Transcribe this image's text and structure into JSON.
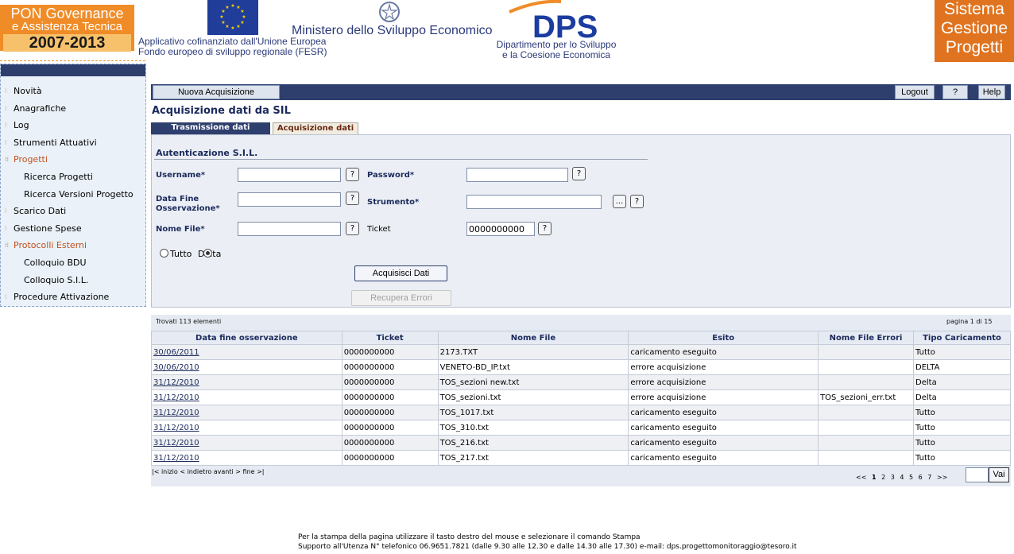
{
  "header": {
    "pon_logo": [
      "PON Governance",
      "e Assistenza Tecnica",
      "2007-2013"
    ],
    "eu_text": [
      "Applicativo cofinanziato dall'Unione Europea",
      "Fondo europeo di sviluppo regionale (FESR)"
    ],
    "ministry": "Ministero dello Sviluppo Economico",
    "dps_logo": "DPS",
    "dps_text": [
      "Dipartimento per lo Sviluppo",
      "e la Coesione Economica"
    ],
    "sgp_logo": [
      "Sistema",
      "Gestione",
      "Progetti"
    ]
  },
  "sidebar": {
    "items": [
      {
        "label": "Novità"
      },
      {
        "label": "Anagrafiche"
      },
      {
        "label": "Log"
      },
      {
        "label": "Strumenti Attuativi"
      },
      {
        "label": "Progetti"
      },
      {
        "label": "Ricerca Progetti"
      },
      {
        "label": "Ricerca Versioni Progetto"
      },
      {
        "label": "Scarico Dati"
      },
      {
        "label": "Gestione Spese"
      },
      {
        "label": "Protocolli Esterni"
      },
      {
        "label": "Colloquio BDU"
      },
      {
        "label": "Colloquio S.I.L."
      },
      {
        "label": "Procedure Attivazione"
      }
    ]
  },
  "toolbar": {
    "new_label": "Nuova Acquisizione",
    "logout_label": "Logout",
    "question_label": "?",
    "help_label": "Help"
  },
  "page": {
    "title": "Acquisizione dati da SIL",
    "tab_transmission": "Trasmissione dati",
    "tab_acquisition": "Acquisizione dati"
  },
  "form": {
    "section_title": "Autenticazione S.I.L.",
    "username_label": "Username*",
    "password_label": "Password*",
    "data_fine_label_1": "Data Fine",
    "data_fine_label_2": "Osservazione*",
    "strumento_label": "Strumento*",
    "nome_file_label": "Nome File*",
    "ticket_label": "Ticket",
    "ticket_value": "0000000000",
    "help_glyph": "?",
    "browse_glyph": "...",
    "radio_tutto": "Tutto",
    "radio_delta": "Delta",
    "acquire_button": "Acquisisci Dati",
    "recover_button": "Recupera Errori"
  },
  "results": {
    "found_text": "Trovati 113 elementi",
    "page_text": "pagina 1 di 15",
    "columns": [
      "Data fine osservazione",
      "Ticket",
      "Nome File",
      "Esito",
      "Nome File Errori",
      "Tipo Caricamento"
    ],
    "rows": [
      [
        "30/06/2011",
        "0000000000",
        "2173.TXT",
        "caricamento eseguito",
        "",
        "Tutto"
      ],
      [
        "30/06/2010",
        "0000000000",
        "VENETO-BD_IP.txt",
        "errore acquisizione",
        "",
        "DELTA"
      ],
      [
        "31/12/2010",
        "0000000000",
        "TOS_sezioni new.txt",
        "errore acquisizione",
        "",
        "Delta"
      ],
      [
        "31/12/2010",
        "0000000000",
        "TOS_sezioni.txt",
        "errore acquisizione",
        "TOS_sezioni_err.txt",
        "Delta"
      ],
      [
        "31/12/2010",
        "0000000000",
        "TOS_1017.txt",
        "caricamento eseguito",
        "",
        "Tutto"
      ],
      [
        "31/12/2010",
        "0000000000",
        "TOS_310.txt",
        "caricamento eseguito",
        "",
        "Tutto"
      ],
      [
        "31/12/2010",
        "0000000000",
        "TOS_216.txt",
        "caricamento eseguito",
        "",
        "Tutto"
      ],
      [
        "31/12/2010",
        "0000000000",
        "TOS_217.txt",
        "caricamento eseguito",
        "",
        "Tutto"
      ]
    ],
    "pager_left": "|< inizio  < indietro avanti >   fine >|",
    "pager_prev": "<<",
    "pager_pages": [
      "1",
      "2",
      "3",
      "4",
      "5",
      "6",
      "7"
    ],
    "pager_next": ">>",
    "go_button": "Vai"
  },
  "footer": {
    "line1": "Per la stampa della pagina utilizzare il tasto destro del mouse e selezionare il comando Stampa",
    "line2": "Supporto all'Utenza N° telefonico 06.9651.7821 (dalle 9.30 alle 12.30 e dalle 14.30 alle 17.30) e-mail: dps.progettomonitoraggio@tesoro.it"
  },
  "colors": {
    "nav_dark": "#2e3f6e",
    "accent_orange": "#f08c28",
    "active_menu": "#c0501c"
  }
}
